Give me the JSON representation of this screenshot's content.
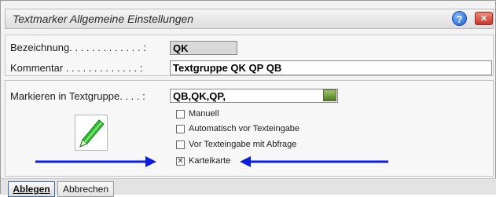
{
  "window": {
    "title": "Textmarker Allgemeine Einstellungen",
    "help_glyph": "?",
    "close_glyph": "✕"
  },
  "fields": {
    "bezeichnung_label": "Bezeichnung. . . . . . . . . . . . . :",
    "bezeichnung_value": "QK",
    "kommentar_label": "Kommentar . . . . . . . . . . . . . :",
    "kommentar_value": "Textgruppe QK QP QB",
    "markieren_label": "Markieren in Textgruppe. . . . :",
    "markieren_value": "QB,QK,QP,"
  },
  "options": [
    {
      "label": "Manuell",
      "checked": false,
      "mark": ""
    },
    {
      "label": "Automatisch vor Texteingabe",
      "checked": false,
      "mark": ""
    },
    {
      "label": "Vor Texteingabe mit Abfrage",
      "checked": false,
      "mark": ""
    },
    {
      "label": "Karteikarte",
      "checked": true,
      "mark": "✕"
    }
  ],
  "footer": {
    "ok_label": "Ablegen",
    "cancel_label": "Abbrechen"
  },
  "colors": {
    "arrow": "#0a1ee0",
    "pencil": "#2fc02f"
  }
}
